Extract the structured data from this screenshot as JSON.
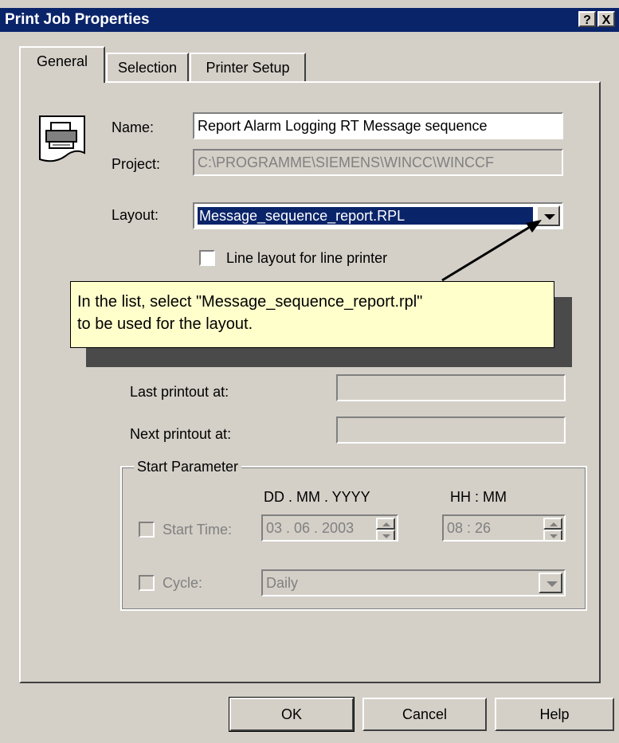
{
  "window": {
    "title": "Print Job Properties",
    "help_button": "?",
    "close_button": "X"
  },
  "tabs": [
    {
      "label": "General",
      "active": true
    },
    {
      "label": "Selection",
      "active": false
    },
    {
      "label": "Printer Setup",
      "active": false
    }
  ],
  "general": {
    "name_label": "Name:",
    "name_value": "Report Alarm Logging RT Message sequence",
    "project_label": "Project:",
    "project_value": "C:\\PROGRAMME\\SIEMENS\\WINCC\\WINCCF",
    "layout_label": "Layout:",
    "layout_value": "Message_sequence_report.RPL",
    "line_layout_label": "Line layout for line printer",
    "line_layout_checked": false,
    "last_printout_label": "Last printout at:",
    "last_printout_value": "",
    "next_printout_label": "Next printout at:",
    "next_printout_value": ""
  },
  "start_parameter": {
    "group_label": "Start Parameter",
    "date_header": "DD . MM . YYYY",
    "time_header": "HH : MM",
    "start_time_label": "Start Time:",
    "start_time_checked": false,
    "date_value": "03  . 06  . 2003",
    "time_value": "08  : 26",
    "cycle_label": "Cycle:",
    "cycle_checked": false,
    "cycle_value": "Daily"
  },
  "callout": {
    "line1": "In the list, select \"Message_sequence_report.rpl\"",
    "line2": "to be used for the layout."
  },
  "buttons": {
    "ok": "OK",
    "cancel": "Cancel",
    "help": "Help"
  },
  "colors": {
    "title_bar": "#0a246a",
    "dialog_face": "#d4d0c8",
    "callout_bg": "#ffffcc",
    "selection": "#0a246a"
  },
  "icons": {
    "printer": "printer-icon",
    "dropdown": "chevron-down-icon",
    "pointer": "arrow-pointer-icon"
  }
}
